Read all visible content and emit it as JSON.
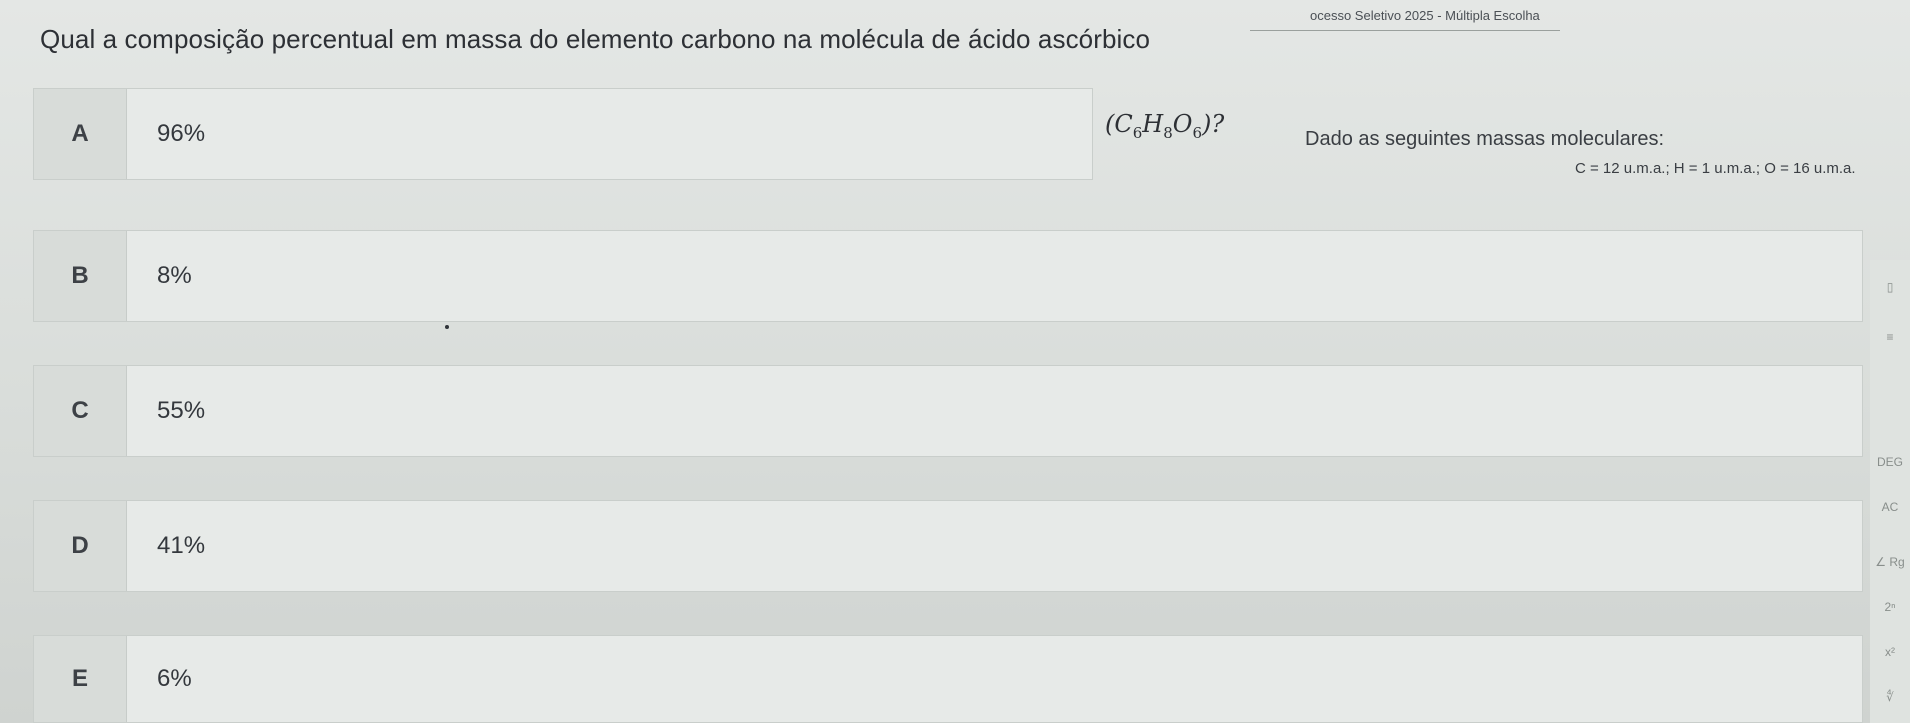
{
  "header": {
    "title": "ocesso Seletivo 2025 - Múltipla Escolha"
  },
  "question": {
    "text": "Qual a composição percentual em massa do elemento carbono na molécula de ácido ascórbico",
    "formula_open": "(",
    "formula_c": "C",
    "formula_c_sub": "6",
    "formula_h": "H",
    "formula_h_sub": "8",
    "formula_o": "O",
    "formula_o_sub": "6",
    "formula_close": ")?",
    "masses_lead": "Dado as seguintes massas moleculares:",
    "masses_values": "C = 12 u.m.a.;  H = 1 u.m.a.; O = 16 u.m.a."
  },
  "options": [
    {
      "letter": "A",
      "value": "96%"
    },
    {
      "letter": "B",
      "value": "8%"
    },
    {
      "letter": "C",
      "value": "55%"
    },
    {
      "letter": "D",
      "value": "41%"
    },
    {
      "letter": "E",
      "value": "6%"
    }
  ],
  "side_tools": [
    {
      "icon": "bookmark-icon",
      "label": "▯"
    },
    {
      "icon": "menu-icon",
      "label": "≡"
    },
    {
      "icon": "deg-icon",
      "label": "DEG"
    },
    {
      "icon": "ac-icon",
      "label": "AC"
    },
    {
      "icon": "angle-icon",
      "label": "∠ Rg"
    },
    {
      "icon": "power-icon",
      "label": "2ⁿ"
    },
    {
      "icon": "square-icon",
      "label": "x²"
    },
    {
      "icon": "root-icon",
      "label": "∜"
    }
  ]
}
